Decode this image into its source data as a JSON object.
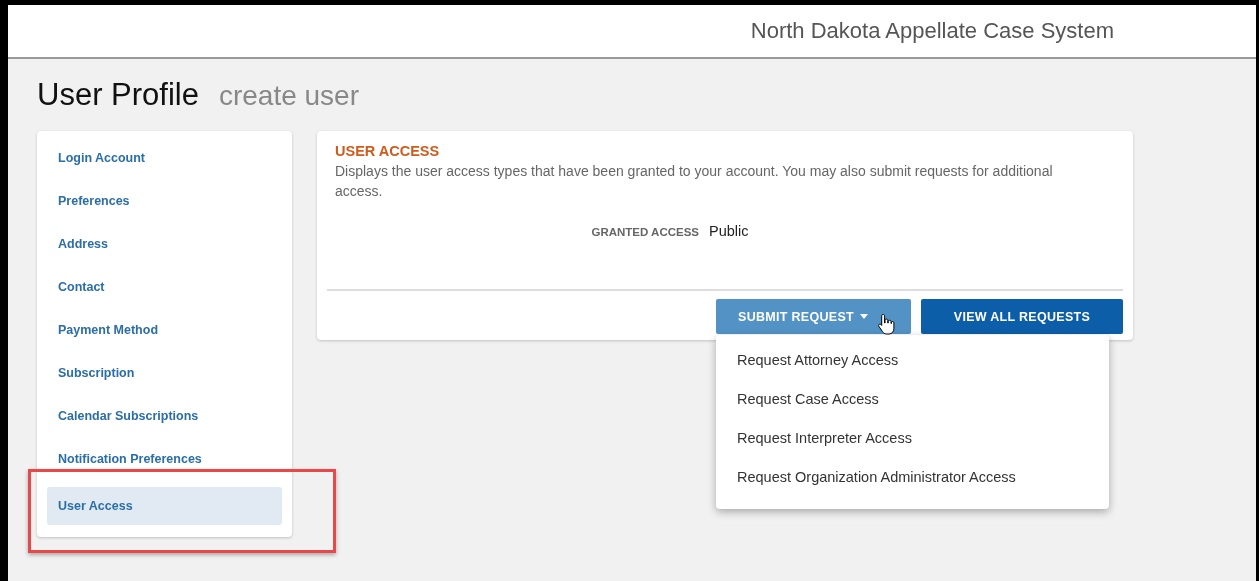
{
  "header": {
    "title": "North Dakota Appellate Case System"
  },
  "page": {
    "title": "User Profile",
    "subtitle": "create user"
  },
  "sidebar": {
    "items": [
      {
        "label": "Login Account",
        "selected": false
      },
      {
        "label": "Preferences",
        "selected": false
      },
      {
        "label": "Address",
        "selected": false
      },
      {
        "label": "Contact",
        "selected": false
      },
      {
        "label": "Payment Method",
        "selected": false
      },
      {
        "label": "Subscription",
        "selected": false
      },
      {
        "label": "Calendar Subscriptions",
        "selected": false
      },
      {
        "label": "Notification Preferences",
        "selected": false
      },
      {
        "label": "User Access",
        "selected": true
      }
    ]
  },
  "card": {
    "heading": "USER ACCESS",
    "description": "Displays the user access types that have been granted to your account. You may also submit requests for additional access.",
    "granted_label": "GRANTED ACCESS",
    "granted_value": "Public",
    "buttons": [
      {
        "label": "SUBMIT REQUEST",
        "kind": "dropdown",
        "expanded": true
      },
      {
        "label": "VIEW ALL REQUESTS",
        "kind": "primary"
      }
    ]
  },
  "menu": {
    "items": [
      "Request Attorney Access",
      "Request Case Access",
      "Request Interpreter Access",
      "Request Organization Administrator Access"
    ]
  }
}
